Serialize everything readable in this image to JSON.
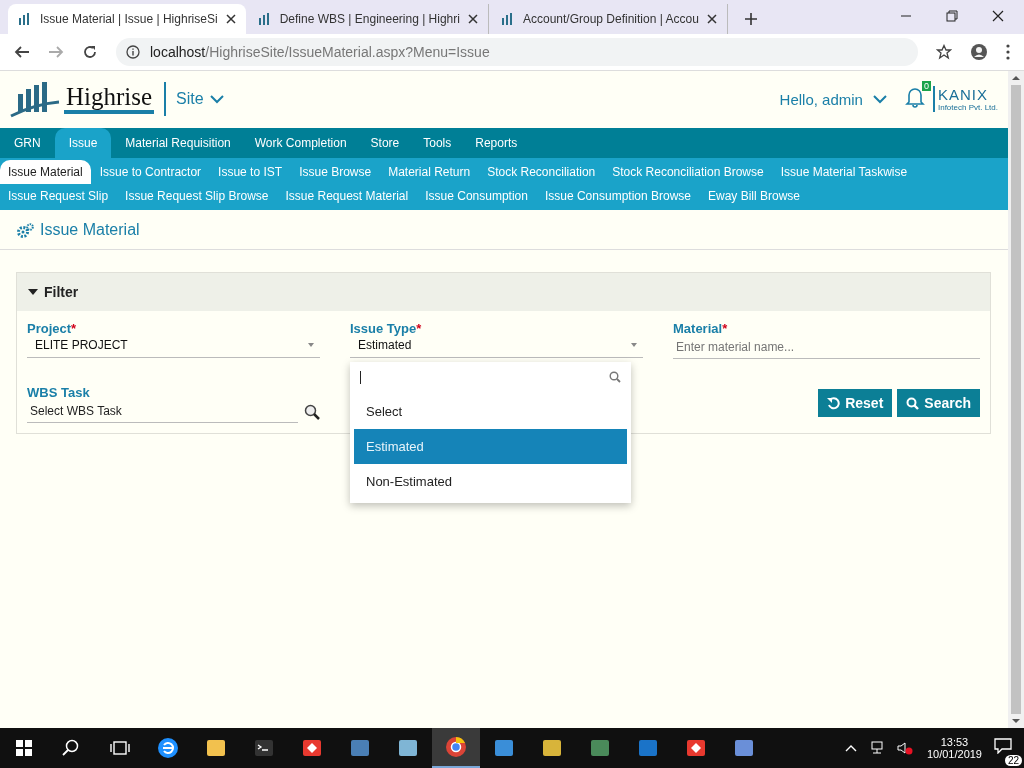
{
  "browser": {
    "tabs": [
      {
        "label": "Issue Material | Issue | HighriseSi",
        "selected": true
      },
      {
        "label": "Define WBS | Engineering | Highri",
        "selected": false
      },
      {
        "label": "Account/Group Definition | Accou",
        "selected": false
      }
    ],
    "url_host": "localhost",
    "url_path": "/HighriseSite/IssueMaterial.aspx?Menu=Issue"
  },
  "header": {
    "logo": "Highrise",
    "site": "Site",
    "greeting": "Hello, admin",
    "notifications": "0",
    "brand": "KANIX",
    "brand_sub": "Infotech Pvt. Ltd."
  },
  "menu": [
    {
      "label": "GRN",
      "selected": false
    },
    {
      "label": "Issue",
      "selected": true
    },
    {
      "label": "Material Requisition",
      "selected": false
    },
    {
      "label": "Work Completion",
      "selected": false
    },
    {
      "label": "Store",
      "selected": false
    },
    {
      "label": "Tools",
      "selected": false
    },
    {
      "label": "Reports",
      "selected": false
    }
  ],
  "submenu": [
    {
      "label": "Issue Material",
      "selected": true
    },
    {
      "label": "Issue to Contractor",
      "selected": false
    },
    {
      "label": "Issue to IST",
      "selected": false
    },
    {
      "label": "Issue Browse",
      "selected": false
    },
    {
      "label": "Material Return",
      "selected": false
    },
    {
      "label": "Stock Reconciliation",
      "selected": false
    },
    {
      "label": "Stock Reconciliation Browse",
      "selected": false
    },
    {
      "label": "Issue Material Taskwise",
      "selected": false
    },
    {
      "label": "Issue Request Slip",
      "selected": false
    },
    {
      "label": "Issue Request Slip Browse",
      "selected": false
    },
    {
      "label": "Issue Request Material",
      "selected": false
    },
    {
      "label": "Issue Consumption",
      "selected": false
    },
    {
      "label": "Issue Consumption Browse",
      "selected": false
    },
    {
      "label": "Eway Bill Browse",
      "selected": false
    }
  ],
  "page_title": "Issue Material",
  "filter": {
    "title": "Filter",
    "expanded": true,
    "fields": [
      {
        "kind": "select",
        "label": "Project",
        "required_mark": "*",
        "value": "ELITE PROJECT"
      },
      {
        "kind": "select",
        "label": "Issue Type",
        "required_mark": "*",
        "value": "Estimated",
        "open": true
      },
      {
        "kind": "text",
        "label": "Material",
        "required_mark": "*",
        "placeholder": "Enter material name..."
      },
      {
        "kind": "lookup",
        "label": "WBS Task",
        "placeholder": "Select WBS Task"
      }
    ],
    "buttons": [
      {
        "kind": "reset",
        "label": "Reset"
      },
      {
        "kind": "search",
        "label": "Search"
      }
    ]
  },
  "dropdown": {
    "options": [
      {
        "label": "Select",
        "selected": false
      },
      {
        "label": "Estimated",
        "selected": true
      },
      {
        "label": "Non-Estimated",
        "selected": false
      }
    ]
  },
  "taskbar": {
    "apps": [
      {
        "kind": "ie",
        "selected": false
      },
      {
        "kind": "folder",
        "selected": false
      },
      {
        "kind": "terminal",
        "selected": false
      },
      {
        "kind": "remote",
        "selected": false
      },
      {
        "kind": "server",
        "selected": false
      },
      {
        "kind": "notepad",
        "selected": false
      },
      {
        "kind": "chrome",
        "selected": true
      },
      {
        "kind": "card",
        "selected": false
      },
      {
        "kind": "database",
        "selected": false
      },
      {
        "kind": "monitor",
        "selected": false
      },
      {
        "kind": "shield",
        "selected": false
      },
      {
        "kind": "remote",
        "selected": false
      },
      {
        "kind": "network",
        "selected": false
      }
    ],
    "time": "13:53",
    "date": "10/01/2019",
    "notifications": "22"
  }
}
